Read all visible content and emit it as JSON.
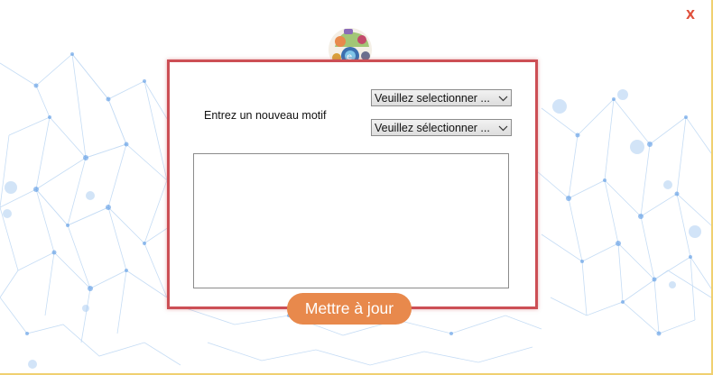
{
  "window": {
    "close_label": "X"
  },
  "form": {
    "motif_label": "Entrez un nouveau motif",
    "select_1": {
      "value": "Veuillez selectionner ..."
    },
    "select_2": {
      "value": "Veuillez sélectionner ..."
    },
    "textarea_value": ""
  },
  "actions": {
    "update_label": "Mettre à jour"
  },
  "colors": {
    "dialog_border": "#cc4f55",
    "button_bg": "#e8894c",
    "close_color": "#e0503c",
    "network_color": "#4a90e2"
  },
  "icons": {
    "logo": "app-logo-icon",
    "chevron": "chevron-down-icon"
  }
}
